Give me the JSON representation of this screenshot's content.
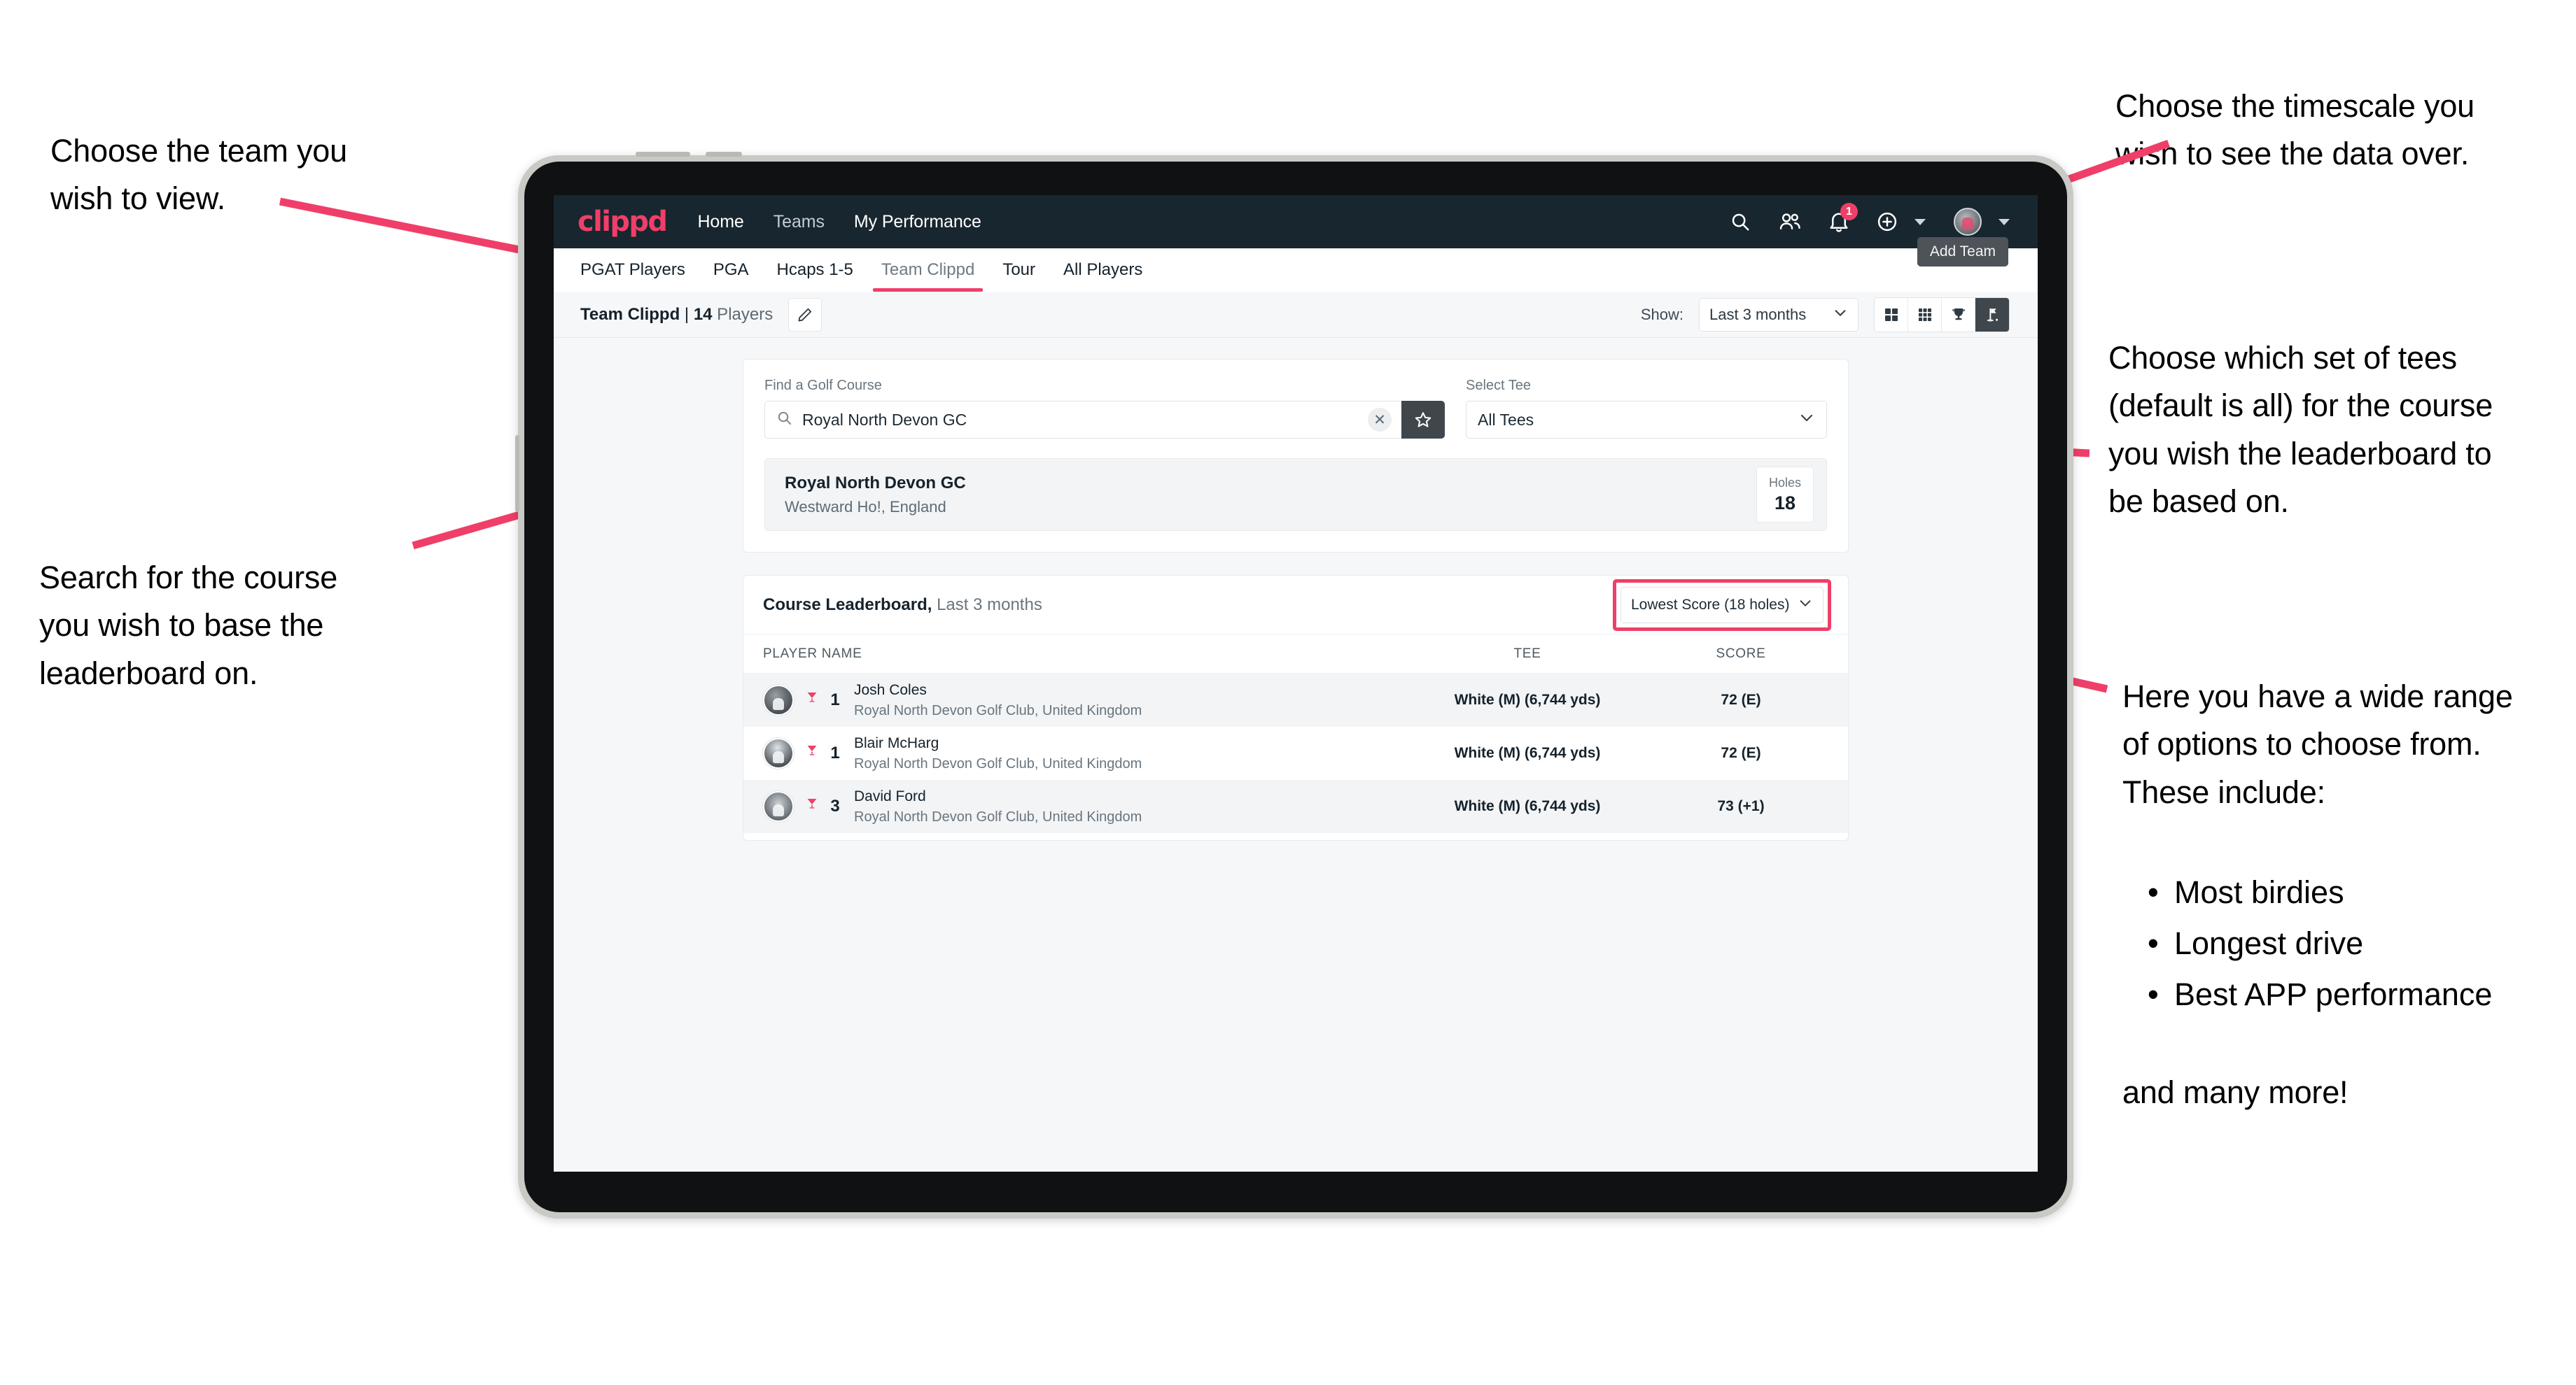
{
  "annotations": {
    "team": "Choose the team you\nwish to view.",
    "timescale": "Choose the timescale you\nwish to see the data over.",
    "tees": "Choose which set of tees\n(default is all) for the course\nyou wish the leaderboard to\nbe based on.",
    "search": "Search for the course\nyou wish to base the\nleaderboard on.",
    "options_intro": "Here you have a wide range\nof options to choose from.\nThese include:",
    "options_items": [
      "Most birdies",
      "Longest drive",
      "Best APP performance"
    ],
    "options_outro": "and many more!"
  },
  "app": {
    "logo": "clippd",
    "nav": [
      {
        "label": "Home",
        "active": true
      },
      {
        "label": "Teams",
        "active": false
      },
      {
        "label": "My Performance",
        "active": true
      }
    ],
    "header_icons": {
      "search": "search-icon",
      "people": "people-icon",
      "notifications": "bell-icon",
      "notification_count": "1",
      "add": "plus-circle-icon",
      "avatar": "user-avatar"
    },
    "tabs": [
      {
        "label": "PGAT Players",
        "active": false
      },
      {
        "label": "PGA",
        "active": false
      },
      {
        "label": "Hcaps 1-5",
        "active": false
      },
      {
        "label": "Team Clippd",
        "active": true
      },
      {
        "label": "Tour",
        "active": false
      },
      {
        "label": "All Players",
        "active": false
      }
    ],
    "tooltip_add_team": "Add Team",
    "subbar": {
      "team_name": "Team Clippd",
      "separator": " | ",
      "player_count": "14",
      "players_word": " Players",
      "edit_icon": "pencil-icon",
      "show_label": "Show:",
      "show_value": "Last 3 months",
      "view_buttons": [
        {
          "name": "grid-large-icon",
          "selected": false
        },
        {
          "name": "grid-small-icon",
          "selected": false
        },
        {
          "name": "trophy-icon",
          "selected": false
        },
        {
          "name": "golf-flag-icon",
          "selected": true
        }
      ]
    },
    "search_panel": {
      "course_label": "Find a Golf Course",
      "course_value": "Royal North Devon GC",
      "course_placeholder": "Find a Golf Course",
      "clear_icon": "close-icon",
      "favorite_icon": "star-icon",
      "tee_label": "Select Tee",
      "tee_value": "All Tees"
    },
    "course_result": {
      "name": "Royal North Devon GC",
      "location": "Westward Ho!, England",
      "holes_label": "Holes",
      "holes_value": "18"
    },
    "leaderboard": {
      "title": "Course Leaderboard,",
      "subtitle": " Last 3 months",
      "metric_value": "Lowest Score (18 holes)",
      "columns": [
        "PLAYER NAME",
        "TEE",
        "SCORE"
      ],
      "rows": [
        {
          "rank": "1",
          "name": "Josh Coles",
          "club": "Royal North Devon Golf Club, United Kingdom",
          "tee": "White (M) (6,744 yds)",
          "score": "72 (E)"
        },
        {
          "rank": "1",
          "name": "Blair McHarg",
          "club": "Royal North Devon Golf Club, United Kingdom",
          "tee": "White (M) (6,744 yds)",
          "score": "72 (E)"
        },
        {
          "rank": "3",
          "name": "David Ford",
          "club": "Royal North Devon Golf Club, United Kingdom",
          "tee": "White (M) (6,744 yds)",
          "score": "73 (+1)"
        }
      ]
    }
  },
  "colors": {
    "accent": "#ef3f69",
    "header_bg": "#18262f",
    "dark_btn": "#3f474d",
    "page_bg": "#f6f7f9"
  }
}
